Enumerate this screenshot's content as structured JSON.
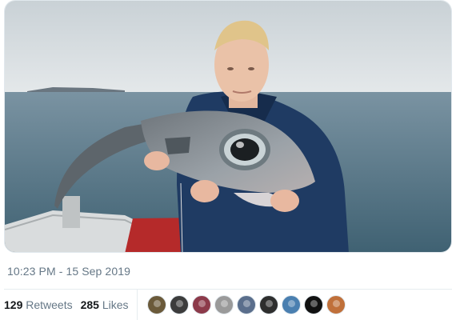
{
  "tweet": {
    "timestamp": "10:23 PM - 15 Sep 2019",
    "retweets": {
      "count": "129",
      "label": "Retweets"
    },
    "likes": {
      "count": "285",
      "label": "Likes"
    }
  },
  "media": {
    "icon": "photo-man-holding-fish",
    "colors": {
      "sky": "#d6dce0",
      "sea": "#4f6f80",
      "jacket": "#1f3b63",
      "fish": "#8a8f94"
    }
  },
  "likers": [
    {
      "name": "liker-avatar-1",
      "color": "#6b5a3a"
    },
    {
      "name": "liker-avatar-2",
      "color": "#3c3c3c"
    },
    {
      "name": "liker-avatar-3",
      "color": "#8c3a4a"
    },
    {
      "name": "liker-avatar-4",
      "color": "#9a9a9a"
    },
    {
      "name": "liker-avatar-5",
      "color": "#5a6e8c"
    },
    {
      "name": "liker-avatar-6",
      "color": "#2e2e2e"
    },
    {
      "name": "liker-avatar-7",
      "color": "#4a7fb0"
    },
    {
      "name": "liker-avatar-8",
      "color": "#111111"
    },
    {
      "name": "liker-avatar-9",
      "color": "#c0703a"
    }
  ]
}
